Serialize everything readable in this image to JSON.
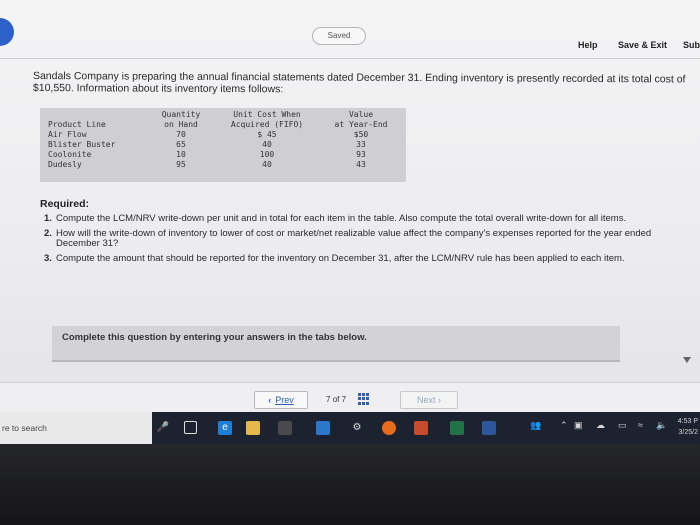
{
  "header": {
    "saved_label": "Saved",
    "help_label": "Help",
    "save_exit_label": "Save & Exit",
    "submit_label": "Sub"
  },
  "intro_text": "Sandals Company is preparing the annual financial statements dated December 31. Ending inventory is presently recorded at its total cost of $10,550. Information about its inventory items follows:",
  "table": {
    "headers": {
      "product_line": "Product Line",
      "qty_line1": "Quantity",
      "qty_line2": "on Hand",
      "cost_line1": "Unit Cost When",
      "cost_line2": "Acquired (FIFO)",
      "value_line1": "Value",
      "value_line2": "at Year-End"
    },
    "rows": [
      {
        "product": "Air Flow",
        "qty": "70",
        "cost": "$ 45",
        "value": "$50"
      },
      {
        "product": "Blister Buster",
        "qty": "65",
        "cost": "40",
        "value": "33"
      },
      {
        "product": "Coolonite",
        "qty": "10",
        "cost": "100",
        "value": "93"
      },
      {
        "product": "Dudesly",
        "qty": "95",
        "cost": "40",
        "value": "43"
      }
    ]
  },
  "required": {
    "title": "Required:",
    "items": [
      {
        "num": "1.",
        "text": "Compute the LCM/NRV write-down per unit and in total for each item in the table. Also compute the total overall write-down for all items."
      },
      {
        "num": "2.",
        "text": "How will the write-down of inventory to lower of cost or market/net realizable value affect the company's expenses reported for the year ended December 31?"
      },
      {
        "num": "3.",
        "text": "Compute the amount that should be reported for the inventory on December 31, after the LCM/NRV rule has been applied to each item."
      }
    ]
  },
  "complete_text": "Complete this question by entering your answers in the tabs below.",
  "nav": {
    "prev_label": "Prev",
    "page_current": "7",
    "page_of": "of",
    "page_total": "7",
    "next_label": "Next"
  },
  "taskbar": {
    "search_text": "re to search",
    "time": "4:53 P",
    "date": "3/25/2"
  },
  "colors": {
    "link_blue": "#2d5fb3",
    "taskbar_bg": "#1d2230",
    "accent_blue": "#2b61c9"
  }
}
